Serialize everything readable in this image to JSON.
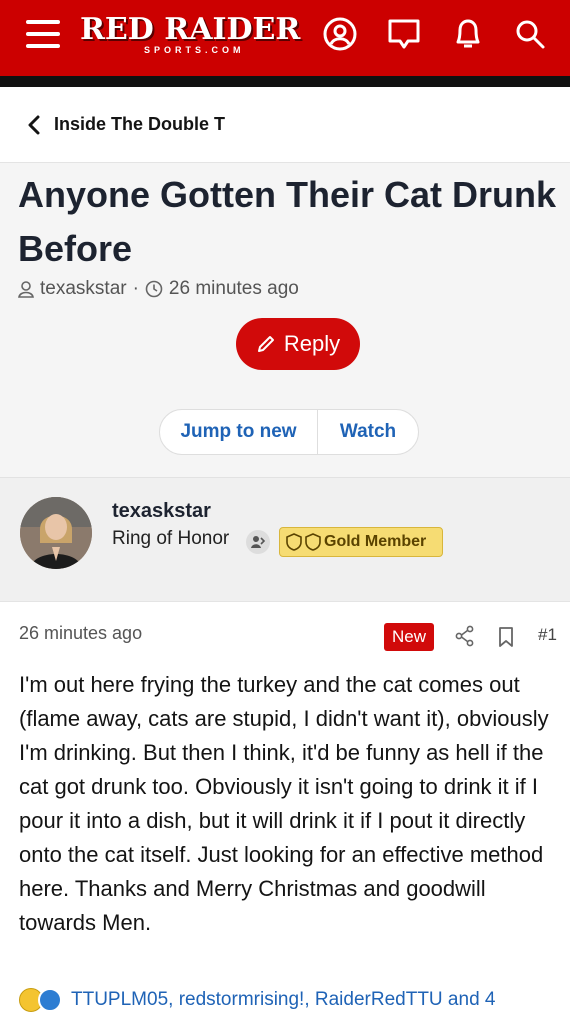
{
  "header": {
    "logo_main": "RED RAIDER",
    "logo_sub": "SPORTS.COM",
    "icons": [
      "menu-icon",
      "account-icon",
      "inbox-icon",
      "alerts-icon",
      "search-icon"
    ],
    "brand_color": "#cc0000"
  },
  "breadcrumb": {
    "label": "Inside The Double T"
  },
  "thread": {
    "title": "Anyone Gotten Their Cat Drunk Before",
    "author": "texaskstar",
    "separator": "·",
    "time": "26 minutes ago",
    "reply_label": "Reply",
    "jump_label": "Jump to new",
    "watch_label": "Watch"
  },
  "author_block": {
    "name": "texaskstar",
    "rank": "Ring of Honor",
    "badge": "Gold Member"
  },
  "post": {
    "time": "26 minutes ago",
    "new_label": "New",
    "number": "#1",
    "body": "I'm out here frying the turkey and the cat comes out (flame away, cats are stupid, I didn't want it), obviously I'm drinking. But then I think, it'd be funny as hell if the cat got drunk too. Obviously it isn't going to drink it if I pour it into a dish, but it will drink it if I pout it directly onto the cat itself. Just looking for an effective method here. Thanks and Merry Christmas and goodwill towards Men.",
    "reactions_text": "TTUPLM05, redstormrising!, RaiderRedTTU and 4"
  }
}
